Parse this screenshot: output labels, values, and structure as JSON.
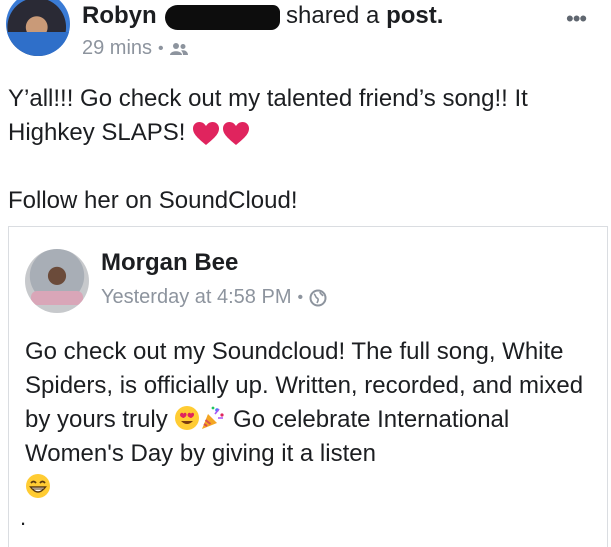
{
  "post": {
    "author": "Robyn",
    "action_prefix": "shared a ",
    "action_object": "post.",
    "more_label": "•••",
    "time": "29 mins",
    "separator": "•",
    "audience_icon": "friends-icon",
    "line1": "Y’all!!! Go check out my talented friend’s song!! It Highkey SLAPS!",
    "line2": "Follow her on SoundCloud!"
  },
  "shared": {
    "author": "Morgan Bee",
    "time": "Yesterday at 4:58 PM",
    "separator": "•",
    "audience_icon": "globe-icon",
    "text_part1": "Go check out my Soundcloud! The full song, White Spiders, is officially up. Written, recorded, and mixed by yours truly ",
    "text_part2": " Go celebrate International Women's Day by giving it a listen",
    "trailing": "."
  },
  "colors": {
    "text": "#1c1e21",
    "meta": "#8d949e",
    "heart": "#e0245e",
    "border": "#dadde1"
  }
}
